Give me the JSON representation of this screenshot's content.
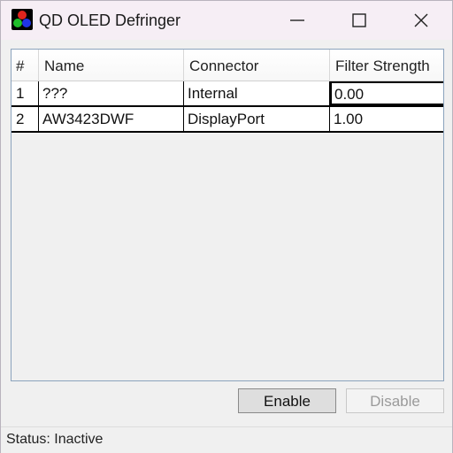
{
  "window": {
    "title": "QD OLED Defringer",
    "icon": "rgb-dots-app-icon",
    "controls": [
      "minimize-icon",
      "maximize-icon",
      "close-icon"
    ]
  },
  "table": {
    "columns": [
      "#",
      "Name",
      "Connector",
      "Filter Strength"
    ],
    "rows": [
      {
        "index": "1",
        "name": "???",
        "connector": "Internal",
        "filter_strength": "0.00"
      },
      {
        "index": "2",
        "name": "AW3423DWF",
        "connector": "DisplayPort",
        "filter_strength": "1.00"
      }
    ]
  },
  "buttons": {
    "enable": "Enable",
    "disable": "Disable"
  },
  "status": {
    "text": "Status: Inactive"
  },
  "colors": {
    "titlebar": "#f6eef5",
    "grid_border": "#8ba3bd",
    "icon_red": "#e0241e",
    "icon_green": "#1fbf2a",
    "icon_blue": "#1f34e6"
  }
}
